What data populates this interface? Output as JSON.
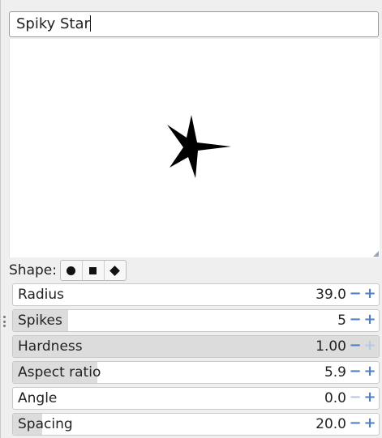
{
  "brush_name": "Spiky Star",
  "shape": {
    "label": "Shape:",
    "options": [
      "circle",
      "square",
      "diamond"
    ],
    "selected": "circle"
  },
  "params": [
    {
      "label": "Radius",
      "value": "39.0",
      "fill": 0.0,
      "minus_enabled": true,
      "plus_enabled": true
    },
    {
      "label": "Spikes",
      "value": "5",
      "fill": 0.15,
      "minus_enabled": true,
      "plus_enabled": true
    },
    {
      "label": "Hardness",
      "value": "1.00",
      "fill": 1.0,
      "minus_enabled": true,
      "plus_enabled": false
    },
    {
      "label": "Aspect ratio",
      "value": "5.9",
      "fill": 0.23,
      "minus_enabled": true,
      "plus_enabled": true
    },
    {
      "label": "Angle",
      "value": "0.0",
      "fill": 0.0,
      "minus_enabled": false,
      "plus_enabled": true
    },
    {
      "label": "Spacing",
      "value": "20.0",
      "fill": 0.08,
      "minus_enabled": true,
      "plus_enabled": true
    }
  ],
  "icons": {
    "minus": "−",
    "plus": "+"
  }
}
